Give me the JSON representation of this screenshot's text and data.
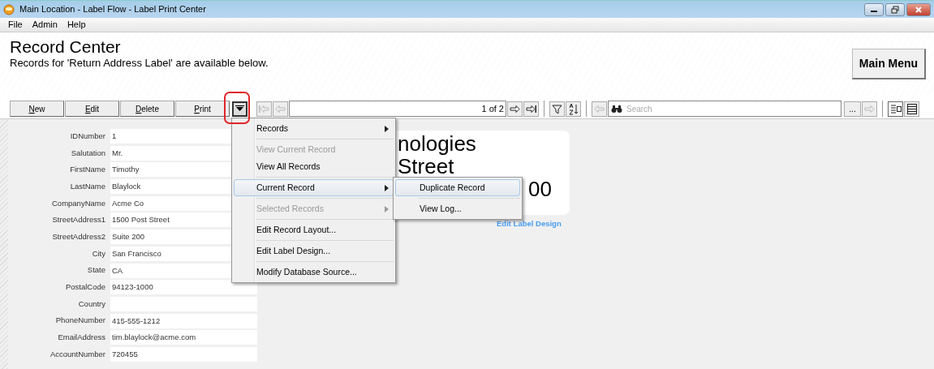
{
  "window": {
    "title": "Main Location - Label Flow - Label Print Center"
  },
  "menu_bar": [
    "File",
    "Admin",
    "Help"
  ],
  "header": {
    "title": "Record Center",
    "subtitle": "Records for 'Return Address Label' are available below."
  },
  "main_menu_button": "Main Menu",
  "toolbar": {
    "buttons": [
      "New",
      "Edit",
      "Delete",
      "Print"
    ],
    "nav_buttons": [
      {
        "kind": "first",
        "disabled": true
      },
      {
        "kind": "prev",
        "disabled": true
      }
    ],
    "position": "1 of 2",
    "nav_buttons_after": [
      {
        "kind": "next",
        "disabled": false
      },
      {
        "kind": "last",
        "disabled": false
      }
    ],
    "tools": [
      {
        "kind": "filter"
      },
      {
        "kind": "sort"
      }
    ],
    "search_back": {
      "kind": "prev",
      "disabled": true
    },
    "search": {
      "placeholder": "Search"
    },
    "more_button": "...",
    "search_forward": {
      "kind": "next",
      "disabled": true
    },
    "views": [
      {
        "kind": "form",
        "selected": true
      },
      {
        "kind": "list",
        "selected": false
      }
    ]
  },
  "record_fields": [
    {
      "label": "IDNumber",
      "value": "1"
    },
    {
      "label": "Salutation",
      "value": "Mr."
    },
    {
      "label": "FirstName",
      "value": "Timothy"
    },
    {
      "label": "LastName",
      "value": "Blaylock"
    },
    {
      "label": "CompanyName",
      "value": "Acme Co"
    },
    {
      "label": "StreetAddress1",
      "value": "1500 Post Street"
    },
    {
      "label": "StreetAddress2",
      "value": "Suite 200"
    },
    {
      "label": "City",
      "value": "San Francisco"
    },
    {
      "label": "State",
      "value": "CA"
    },
    {
      "label": "PostalCode",
      "value": "94123-1000"
    },
    {
      "label": "Country"
    },
    {
      "label": "PhoneNumber",
      "value": "415-555-1212"
    },
    {
      "label": "EmailAddress",
      "value": "tim.blaylock@acme.com"
    },
    {
      "label": "AccountNumber",
      "value": "720455"
    }
  ],
  "label_preview": {
    "lines": [
      "nologies",
      "Street",
      "00"
    ],
    "edit_link": "Edit Label Design"
  },
  "context_menu": [
    {
      "label": "Records",
      "disabled": false,
      "submenu": true,
      "selected": false,
      "separator_after": true
    },
    {
      "label": "View Current Record",
      "disabled": true,
      "submenu": false,
      "selected": false,
      "separator_after": false
    },
    {
      "label": "View All Records",
      "disabled": false,
      "submenu": false,
      "selected": false,
      "separator_after": true
    },
    {
      "label": "Current Record",
      "disabled": false,
      "submenu": true,
      "selected": true,
      "separator_after": true
    },
    {
      "label": "Selected Records",
      "disabled": true,
      "submenu": true,
      "selected": false,
      "separator_after": true
    },
    {
      "label": "Edit Record Layout...",
      "disabled": false,
      "submenu": false,
      "selected": false,
      "separator_after": true
    },
    {
      "label": "Edit Label Design...",
      "disabled": false,
      "submenu": false,
      "selected": false,
      "separator_after": true
    },
    {
      "label": "Modify Database Source...",
      "disabled": false,
      "submenu": false,
      "selected": false,
      "separator_after": false
    }
  ],
  "submenu": [
    {
      "label": "Duplicate Record",
      "selected": true
    },
    {
      "label": "View Log...",
      "selected": false
    }
  ]
}
